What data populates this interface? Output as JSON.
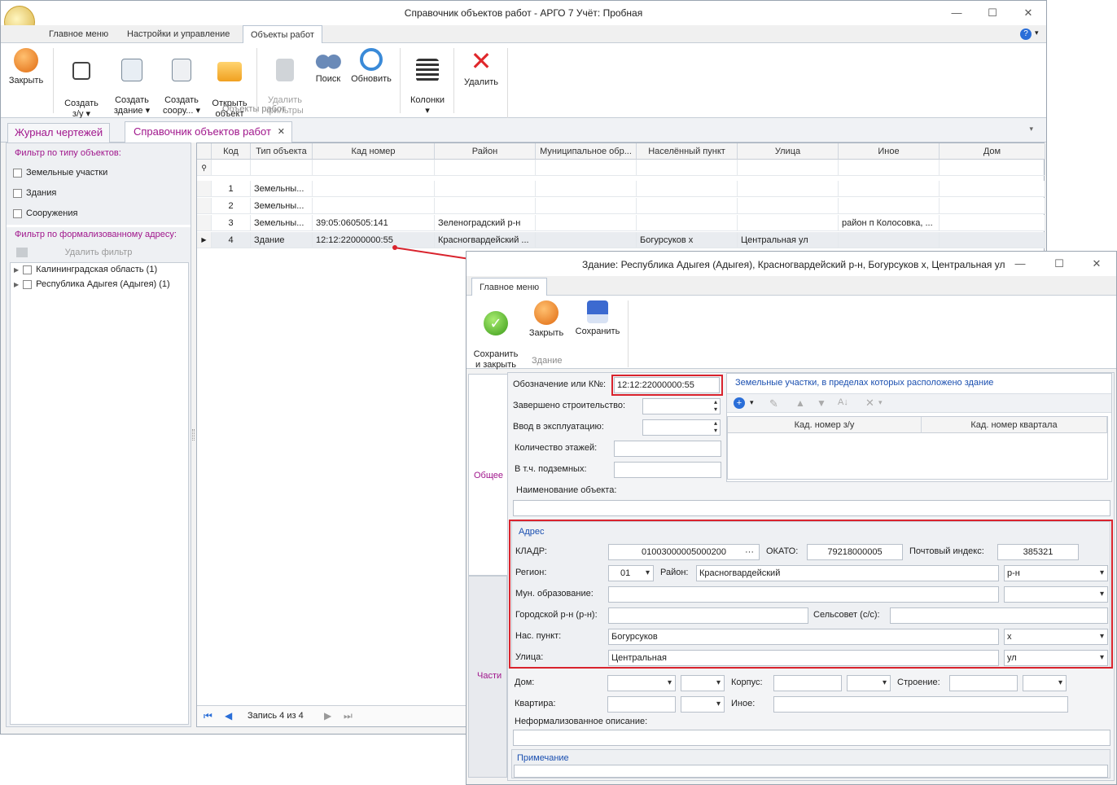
{
  "main": {
    "title": "Справочник объектов работ - АРГО 7 Учёт: Пробная",
    "menu_tabs": [
      "Главное меню",
      "Настройки и управление",
      "Объекты работ"
    ],
    "ribbon_buttons": [
      {
        "label": "Закрыть",
        "icon": "exit-icon"
      },
      {
        "label": "Создать\nз/у ▾",
        "icon": "land-plot-icon"
      },
      {
        "label": "Создать\nздание ▾",
        "icon": "building-icon"
      },
      {
        "label": "Создать\nсоору... ▾",
        "icon": "structure-icon"
      },
      {
        "label": "Открыть\nобъект",
        "icon": "folder-icon"
      },
      {
        "label": "Удалить\nфильтры",
        "icon": "filter-icon"
      },
      {
        "label": "Поиск",
        "icon": "binoculars-icon"
      },
      {
        "label": "Обновить",
        "icon": "refresh-icon"
      },
      {
        "label": "Колонки\n▾",
        "icon": "columns-icon"
      },
      {
        "label": "Удалить",
        "icon": "delete-icon"
      }
    ],
    "ribbon_group": "Объекты работ",
    "doc_tabs": [
      "Журнал чертежей",
      "Справочник объектов работ"
    ],
    "filter_type_title": "Фильтр по типу объектов:",
    "filter_types": [
      "Земельные участки",
      "Здания",
      "Сооружения"
    ],
    "filter_addr_title": "Фильтр по формализованному адресу:",
    "remove_filter": "Удалить фильтр",
    "tree": [
      "Калининградская область (1)",
      "Республика Адыгея (Адыгея) (1)"
    ],
    "columns": [
      "Код",
      "Тип объекта",
      "Кад номер",
      "Район",
      "Муниципальное обр...",
      "Населённый пункт",
      "Улица",
      "Иное",
      "Дом"
    ],
    "rows": [
      [
        "1",
        "Земельны...",
        "",
        "",
        "",
        "",
        "",
        "",
        ""
      ],
      [
        "2",
        "Земельны...",
        "",
        "",
        "",
        "",
        "",
        "",
        ""
      ],
      [
        "3",
        "Земельны...",
        "39:05:060505:141",
        "Зеленоградский р-н",
        "",
        "",
        "",
        "район п Колосовка, ...",
        ""
      ],
      [
        "4",
        "Здание",
        "12:12:22000000:55",
        "Красногвардейский ...",
        "",
        "Богурсуков х",
        "Центральная ул",
        "",
        ""
      ]
    ],
    "record_info": "Запись 4 из 4"
  },
  "dialog": {
    "title": "Здание: Республика Адыгея (Адыгея), Красногвардейский р-н, Богурсуков х, Центральная ул",
    "menu_tab": "Главное меню",
    "buttons": [
      {
        "label": "Сохранить\nи закрыть",
        "icon": "check-icon"
      },
      {
        "label": "Закрыть",
        "icon": "exit-icon"
      },
      {
        "label": "Сохранить",
        "icon": "save-icon"
      }
    ],
    "group": "Здание",
    "side_tabs": [
      "Общее",
      "Части"
    ],
    "labels": {
      "kn": "Обозначение или К№:",
      "built": "Завершено строительство:",
      "commission": "Ввод в эксплуатацию:",
      "floors": "Количество этажей:",
      "underground": "В т.ч. подземных:",
      "name": "Наименование объекта:",
      "address": "Адрес",
      "kladr": "КЛАДР:",
      "okato": "ОКАТО:",
      "postal": "Почтовый индекс:",
      "region": "Регион:",
      "district": "Район:",
      "mun": "Мун. образование:",
      "city_district": "Городской р-н (р-н):",
      "village_council": "Сельсовет (с/с):",
      "locality": "Нас. пункт:",
      "street": "Улица:",
      "house": "Дом:",
      "korpus": "Корпус:",
      "building": "Строение:",
      "apartment": "Квартира:",
      "other": "Иное:",
      "informal": "Неформализованное описание:",
      "note": "Примечание"
    },
    "values": {
      "kn": "12:12:22000000:55",
      "kladr": "01003000005000200",
      "okato": "79218000005",
      "postal": "385321",
      "region": "01",
      "district": "Красногвардейский",
      "district_type": "р-н",
      "locality": "Богурсуков",
      "locality_type": "х",
      "street": "Центральная",
      "street_type": "ул"
    },
    "land_panel": {
      "title": "Земельные участки, в пределах которых расположено здание",
      "columns": [
        "Кад. номер з/у",
        "Кад. номер квартала"
      ]
    }
  }
}
